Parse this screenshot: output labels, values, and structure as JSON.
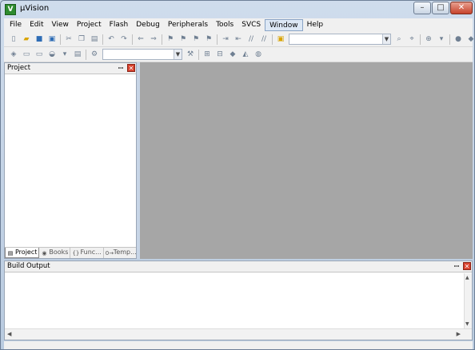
{
  "window": {
    "title": "µVision",
    "app_icon_glyph": "V",
    "minimize": "–",
    "maximize": "□",
    "close": "✕"
  },
  "menu": {
    "items": [
      {
        "label": "File"
      },
      {
        "label": "Edit"
      },
      {
        "label": "View"
      },
      {
        "label": "Project"
      },
      {
        "label": "Flash"
      },
      {
        "label": "Debug"
      },
      {
        "label": "Peripherals"
      },
      {
        "label": "Tools"
      },
      {
        "label": "SVCS"
      },
      {
        "label": "Window"
      },
      {
        "label": "Help"
      }
    ]
  },
  "project_panel": {
    "title": "Project",
    "pin": "ꟷ",
    "close": "✕",
    "tabs": [
      {
        "label": "Project",
        "icon": "▤"
      },
      {
        "label": "Books",
        "icon": "◉"
      },
      {
        "label": "Func...",
        "icon": "{}"
      },
      {
        "label": "Temp...",
        "icon": "0→"
      }
    ]
  },
  "build_panel": {
    "title": "Build Output",
    "pin": "ꟷ",
    "close": "✕"
  },
  "scroll": {
    "up": "▲",
    "down": "▼",
    "left": "◀",
    "right": "▶"
  },
  "combo": {
    "arrow": "▼"
  },
  "colors": {
    "workspace": "#a6a6a6",
    "close_red": "#d9432f",
    "frame": "#c8d6e6"
  }
}
